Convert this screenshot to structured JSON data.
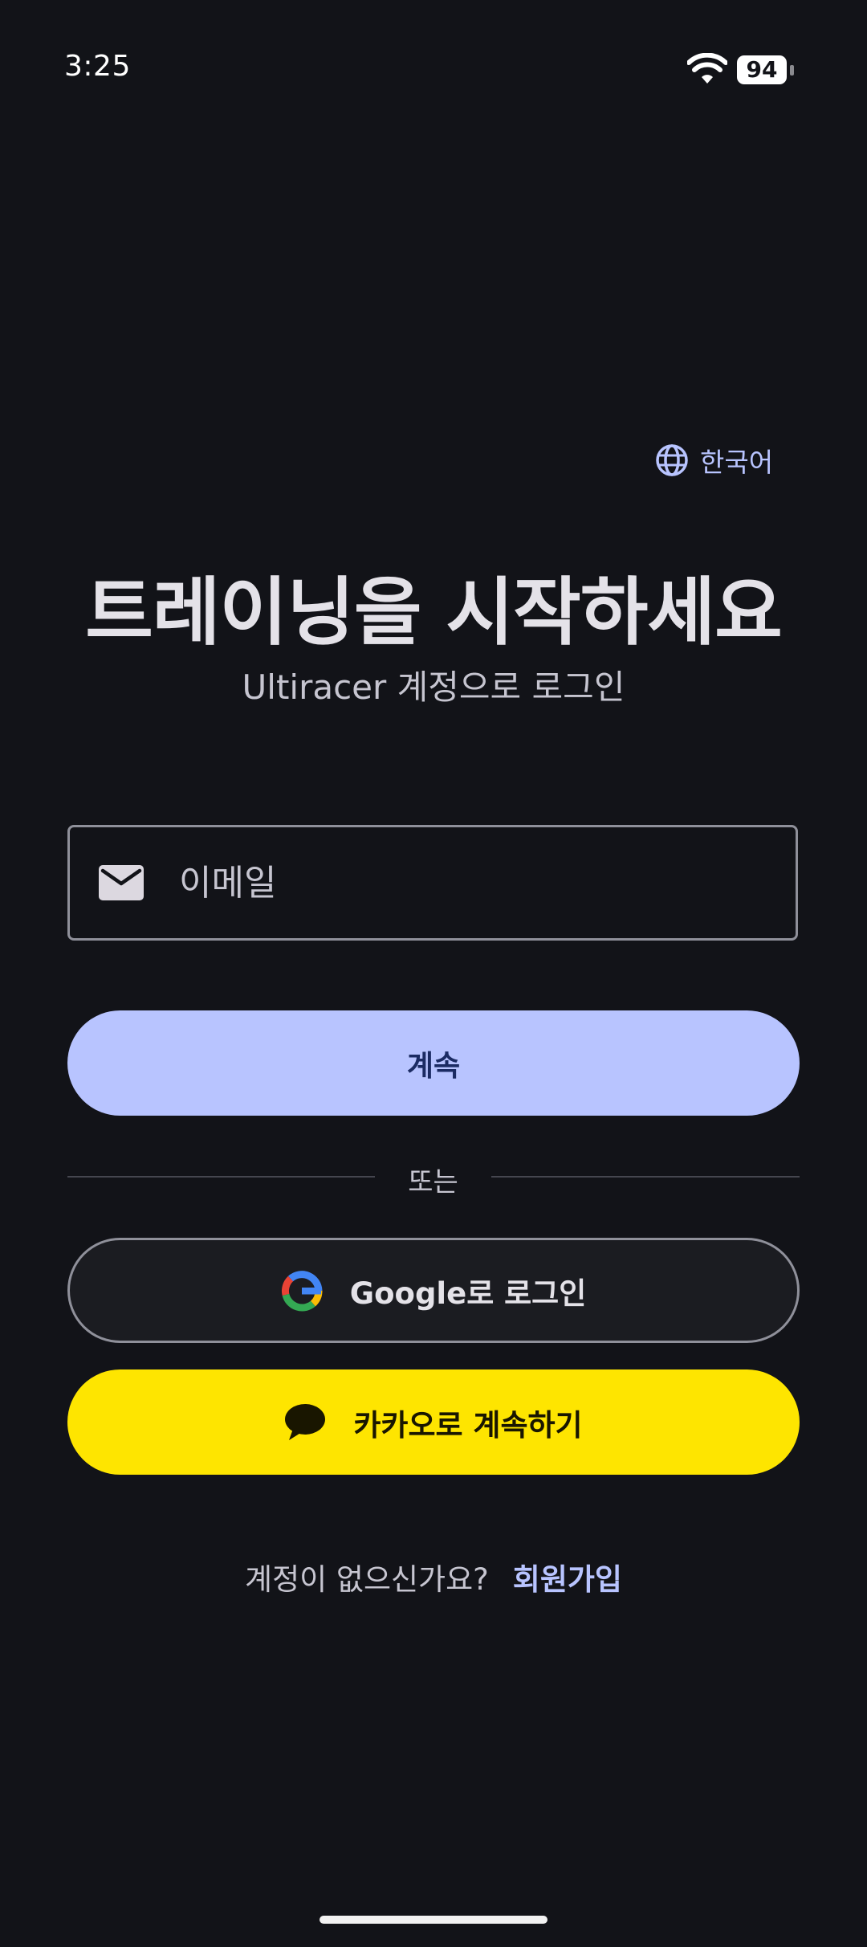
{
  "status_bar": {
    "time": "3:25",
    "battery_level": "94",
    "icons": [
      "wifi-icon",
      "battery-icon"
    ]
  },
  "language": {
    "label": "한국어",
    "icon": "globe-icon"
  },
  "header": {
    "title": "트레이닝을 시작하세요",
    "subtitle": "Ultiracer 계정으로 로그인"
  },
  "email_field": {
    "placeholder": "이메일",
    "value": "",
    "icon": "mail-icon"
  },
  "continue_button": {
    "label": "계속"
  },
  "divider": {
    "label": "또는"
  },
  "google_button": {
    "label": "Google로 로그인",
    "icon": "google-icon"
  },
  "kakao_button": {
    "label": "카카오로 계속하기",
    "icon": "kakao-chat-icon"
  },
  "signup": {
    "prompt": "계정이 없으신가요?",
    "link": "회원가입"
  },
  "colors": {
    "background": "#121318",
    "accent": "#b8c4ff",
    "kakao_yellow": "#fee500",
    "outline": "#8f909a"
  }
}
